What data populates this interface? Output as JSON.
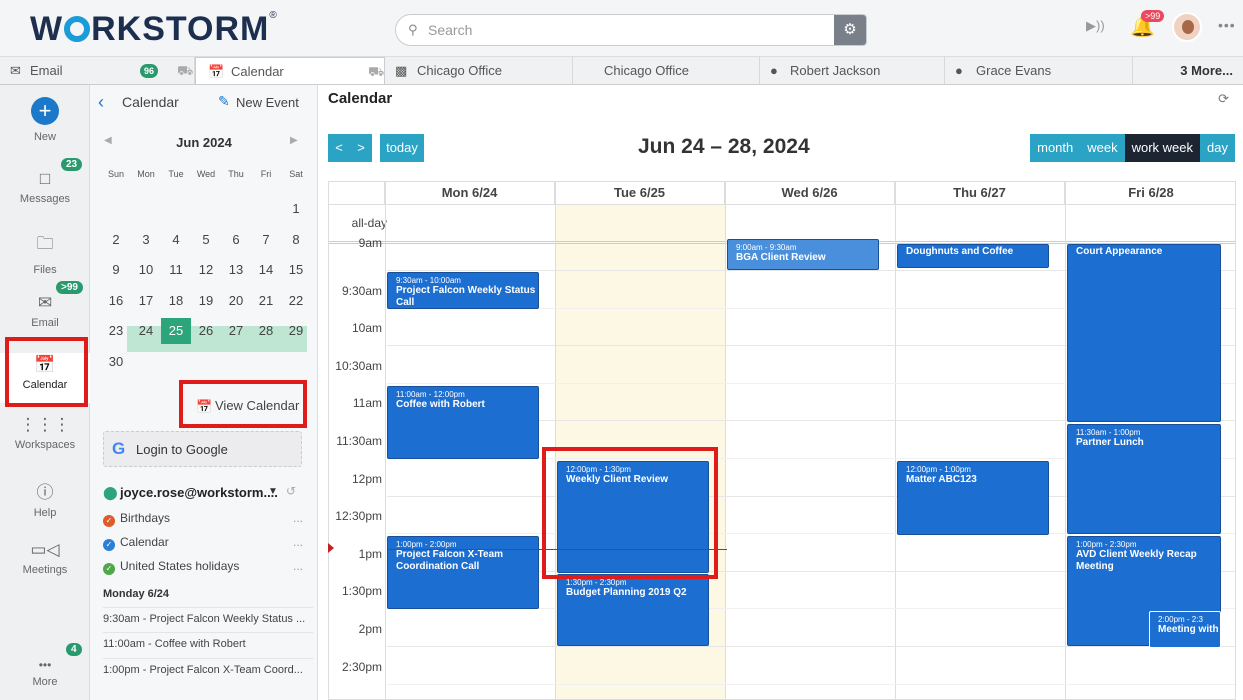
{
  "app": {
    "logo": "WORKSTORM",
    "logo_mark": "®"
  },
  "header": {
    "search_placeholder": "Search",
    "notif_badge": ">99"
  },
  "tabs": [
    {
      "label": "Email",
      "badge": "96"
    },
    {
      "label": "Calendar"
    },
    {
      "label": "Chicago Office"
    },
    {
      "label": "Chicago Office"
    },
    {
      "label": "Robert Jackson"
    },
    {
      "label": "Grace Evans"
    }
  ],
  "tabs_more": "3 More...",
  "sidebar": {
    "new": "New",
    "messages": "Messages",
    "messages_badge": "23",
    "files": "Files",
    "email": "Email",
    "email_badge": ">99",
    "calendar": "Calendar",
    "workspaces": "Workspaces",
    "help": "Help",
    "meetings": "Meetings",
    "more": "More",
    "more_badge": "4"
  },
  "calpanel": {
    "back_label": "Calendar",
    "new_event": "New Event",
    "month_title": "Jun 2024",
    "dow": [
      "Sun",
      "Mon",
      "Tue",
      "Wed",
      "Thu",
      "Fri",
      "Sat"
    ],
    "weeks": [
      [
        "",
        "",
        "",
        "",
        "",
        "",
        "1"
      ],
      [
        "2",
        "3",
        "4",
        "5",
        "6",
        "7",
        "8"
      ],
      [
        "9",
        "10",
        "11",
        "12",
        "13",
        "14",
        "15"
      ],
      [
        "16",
        "17",
        "18",
        "19",
        "20",
        "21",
        "22"
      ],
      [
        "23",
        "24",
        "25",
        "26",
        "27",
        "28",
        "29"
      ],
      [
        "30",
        "",
        "",
        "",
        "",
        "",
        ""
      ]
    ],
    "view_calendar": "View Calendar",
    "google_login": "Login to Google",
    "account": "joyce.rose@workstorm....",
    "calendars": [
      {
        "label": "Birthdays",
        "color": "#e05a2b"
      },
      {
        "label": "Calendar",
        "color": "#2b7fd6"
      },
      {
        "label": "United States holidays",
        "color": "#4ea84a"
      }
    ],
    "agenda_heading": "Monday 6/24",
    "agenda": [
      "9:30am - Project Falcon Weekly Status ...",
      "11:00am - Coffee with Robert",
      "1:00pm - Project Falcon X-Team Coord..."
    ]
  },
  "main": {
    "title": "Calendar",
    "prev": "<",
    "next": ">",
    "today": "today",
    "range": "Jun 24 – 28, 2024",
    "views": [
      "month",
      "week",
      "work week",
      "day"
    ],
    "active_view": "work week",
    "columns": [
      "Mon 6/24",
      "Tue 6/25",
      "Wed 6/26",
      "Thu 6/27",
      "Fri 6/28"
    ],
    "allday_label": "all-day",
    "times": [
      "9am",
      "9:30am",
      "10am",
      "10:30am",
      "11am",
      "11:30am",
      "12pm",
      "12:30pm",
      "1pm",
      "1:30pm",
      "2pm",
      "2:30pm"
    ]
  },
  "events": {
    "wed_bga_time": "9:00am - 9:30am",
    "wed_bga": "BGA Client Review",
    "thu_doughnuts": "Doughnuts and Coffee",
    "fri_court": "Court Appearance",
    "mon_falcon_time": "9:30am - 10:00am",
    "mon_falcon": "Project Falcon Weekly Status Call",
    "mon_coffee_time": "11:00am - 12:00pm",
    "mon_coffee": "Coffee with Robert",
    "fri_lunch_time": "11:30am - 1:00pm",
    "fri_lunch": "Partner Lunch",
    "tue_review_time": "12:00pm - 1:30pm",
    "tue_review": "Weekly Client Review",
    "thu_matter_time": "12:00pm - 1:00pm",
    "thu_matter": "Matter ABC123",
    "mon_xteam_time": "1:00pm - 2:00pm",
    "mon_xteam": "Project Falcon X-Team Coordination Call",
    "fri_avd_time": "1:00pm - 2:30pm",
    "fri_avd": "AVD Client Weekly Recap Meeting",
    "tue_budget_time": "1:30pm - 2:30pm",
    "tue_budget": "Budget Planning 2019 Q2",
    "fri_meeting_time": "2:00pm - 2:3",
    "fri_meeting": "Meeting with"
  }
}
